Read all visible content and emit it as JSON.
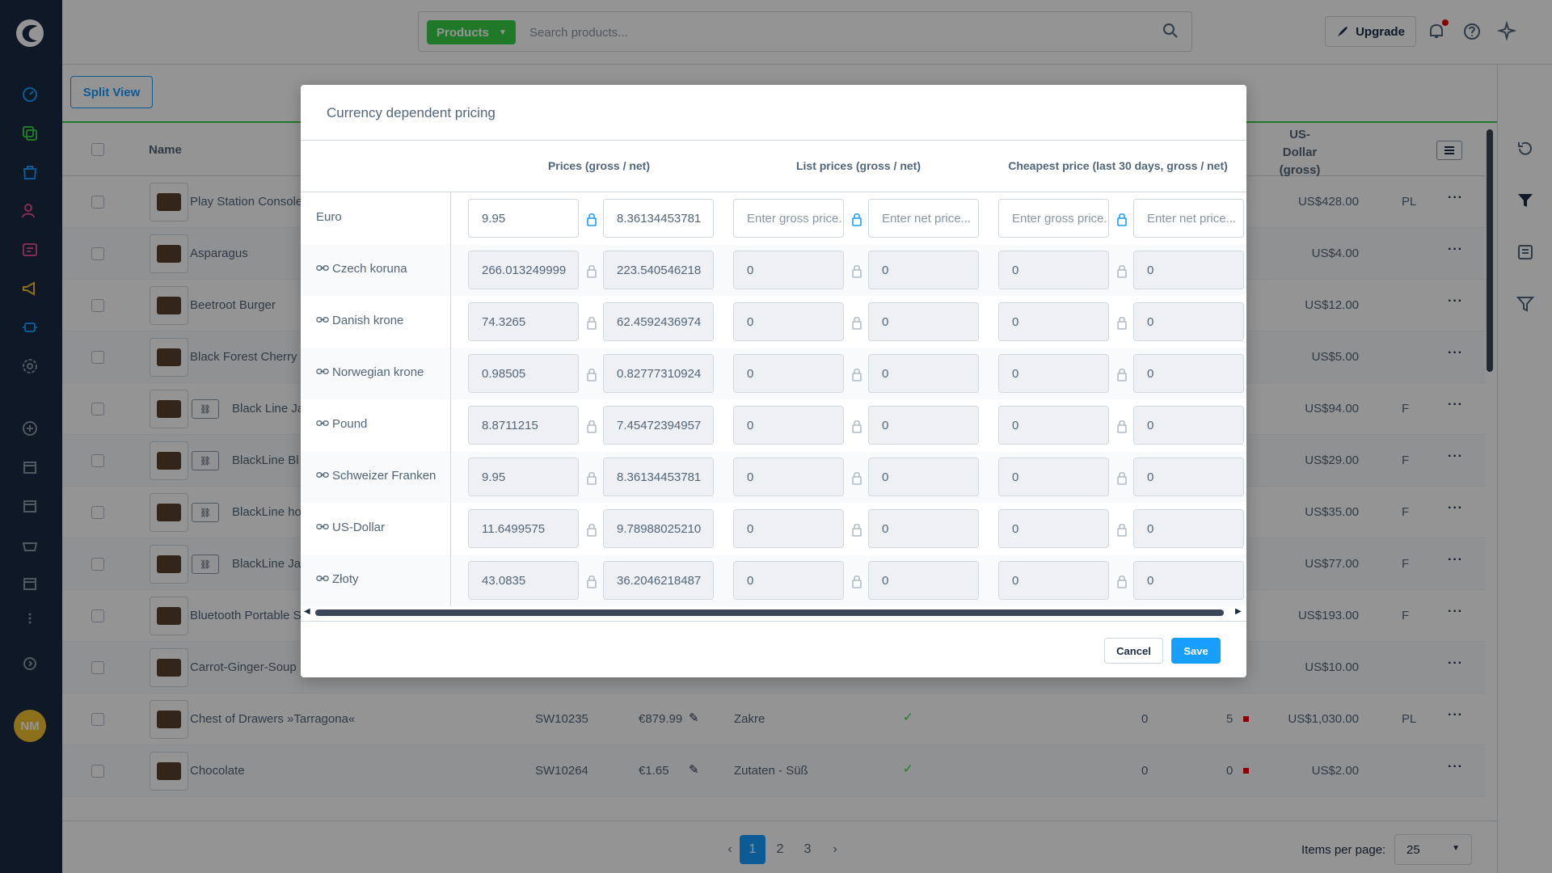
{
  "topbar": {
    "search_type": "Products",
    "search_placeholder": "Search products...",
    "upgrade": "Upgrade"
  },
  "toolbar": {
    "split_view": "Split View"
  },
  "grid": {
    "name_header": "Name",
    "usd_header": "US-\nDollar\n(gross)",
    "rows": [
      {
        "name": "Play Station Console",
        "num": "",
        "price": "",
        "mfr": "",
        "stock": "",
        "avail": "",
        "usd": "US$428.00",
        "pl": "PL",
        "variant": false
      },
      {
        "name": "Asparagus",
        "num": "",
        "price": "",
        "mfr": "",
        "stock": "",
        "avail": "",
        "usd": "US$4.00",
        "pl": "",
        "variant": false
      },
      {
        "name": "Beetroot Burger",
        "num": "",
        "price": "",
        "mfr": "",
        "stock": "",
        "avail": "",
        "usd": "US$12.00",
        "pl": "",
        "variant": false
      },
      {
        "name": "Black Forest Cherry",
        "num": "",
        "price": "",
        "mfr": "",
        "stock": "",
        "avail": "",
        "usd": "US$5.00",
        "pl": "",
        "variant": false
      },
      {
        "name": "Black Line Ja",
        "num": "",
        "price": "",
        "mfr": "",
        "stock": "",
        "avail": "",
        "usd": "US$94.00",
        "pl": "F",
        "variant": true
      },
      {
        "name": "BlackLine Bl",
        "num": "",
        "price": "",
        "mfr": "",
        "stock": "",
        "avail": "",
        "usd": "US$29.00",
        "pl": "F",
        "variant": true
      },
      {
        "name": "BlackLine ho",
        "num": "",
        "price": "",
        "mfr": "",
        "stock": "",
        "avail": "",
        "usd": "US$35.00",
        "pl": "F",
        "variant": true
      },
      {
        "name": "BlackLine Ja",
        "num": "",
        "price": "",
        "mfr": "",
        "stock": "",
        "avail": "",
        "usd": "US$77.00",
        "pl": "F",
        "variant": true
      },
      {
        "name": "Bluetooth Portable S",
        "num": "",
        "price": "",
        "mfr": "",
        "stock": "",
        "avail": "",
        "usd": "US$193.00",
        "pl": "F",
        "variant": false
      },
      {
        "name": "Carrot-Ginger-Soup",
        "num": "",
        "price": "",
        "mfr": "",
        "stock": "",
        "avail": "",
        "usd": "US$10.00",
        "pl": "",
        "variant": false
      },
      {
        "name": "Chest of Drawers »Tarragona«",
        "num": "SW10235",
        "price": "€879.99",
        "mfr": "Zakre",
        "stock": "0",
        "avail": "5",
        "usd": "US$1,030.00",
        "pl": "PL",
        "variant": false
      },
      {
        "name": "Chocolate",
        "num": "SW10264",
        "price": "€1.65",
        "mfr": "Zutaten - Süß",
        "stock": "0",
        "avail": "0",
        "usd": "US$2.00",
        "pl": "",
        "variant": false
      }
    ]
  },
  "pager": {
    "pages": [
      "1",
      "2",
      "3"
    ],
    "items_per_page_label": "Items per page:",
    "items_per_page": "25"
  },
  "modal": {
    "title": "Currency dependent pricing",
    "col_prices": "Prices (gross / net)",
    "col_list": "List prices (gross / net)",
    "col_cheapest": "Cheapest price (last 30 days, gross / net)",
    "rows": [
      {
        "currency": "Euro",
        "linked": false,
        "gross": "9.95",
        "net": "8.36134453781",
        "list_gross": "",
        "list_net": "",
        "cheap_gross": "",
        "cheap_net": ""
      },
      {
        "currency": "Czech koruna",
        "linked": true,
        "gross": "266.013249999",
        "net": "223.540546218",
        "list_gross": "0",
        "list_net": "0",
        "cheap_gross": "0",
        "cheap_net": "0"
      },
      {
        "currency": "Danish krone",
        "linked": true,
        "gross": "74.3265",
        "net": "62.4592436974",
        "list_gross": "0",
        "list_net": "0",
        "cheap_gross": "0",
        "cheap_net": "0"
      },
      {
        "currency": "Norwegian krone",
        "linked": true,
        "gross": "0.98505",
        "net": "0.82777310924",
        "list_gross": "0",
        "list_net": "0",
        "cheap_gross": "0",
        "cheap_net": "0"
      },
      {
        "currency": "Pound",
        "linked": true,
        "gross": "8.8711215",
        "net": "7.45472394957",
        "list_gross": "0",
        "list_net": "0",
        "cheap_gross": "0",
        "cheap_net": "0"
      },
      {
        "currency": "Schweizer Franken",
        "linked": true,
        "gross": "9.95",
        "net": "8.36134453781",
        "list_gross": "0",
        "list_net": "0",
        "cheap_gross": "0",
        "cheap_net": "0"
      },
      {
        "currency": "US-Dollar",
        "linked": true,
        "gross": "11.6499575",
        "net": "9.78988025210",
        "list_gross": "0",
        "list_net": "0",
        "cheap_gross": "0",
        "cheap_net": "0"
      },
      {
        "currency": "Złoty",
        "linked": true,
        "gross": "43.0835",
        "net": "36.2046218487",
        "list_gross": "0",
        "list_net": "0",
        "cheap_gross": "0",
        "cheap_net": "0"
      }
    ],
    "placeholder_gross": "Enter gross price...",
    "placeholder_net": "Enter net price...",
    "cancel": "Cancel",
    "save": "Save"
  },
  "user": {
    "initials": "NM"
  },
  "colors": {
    "accent": "#189eff",
    "green": "#37d046",
    "sidebar": "#1b2a43",
    "avatar": "#f2c230"
  }
}
